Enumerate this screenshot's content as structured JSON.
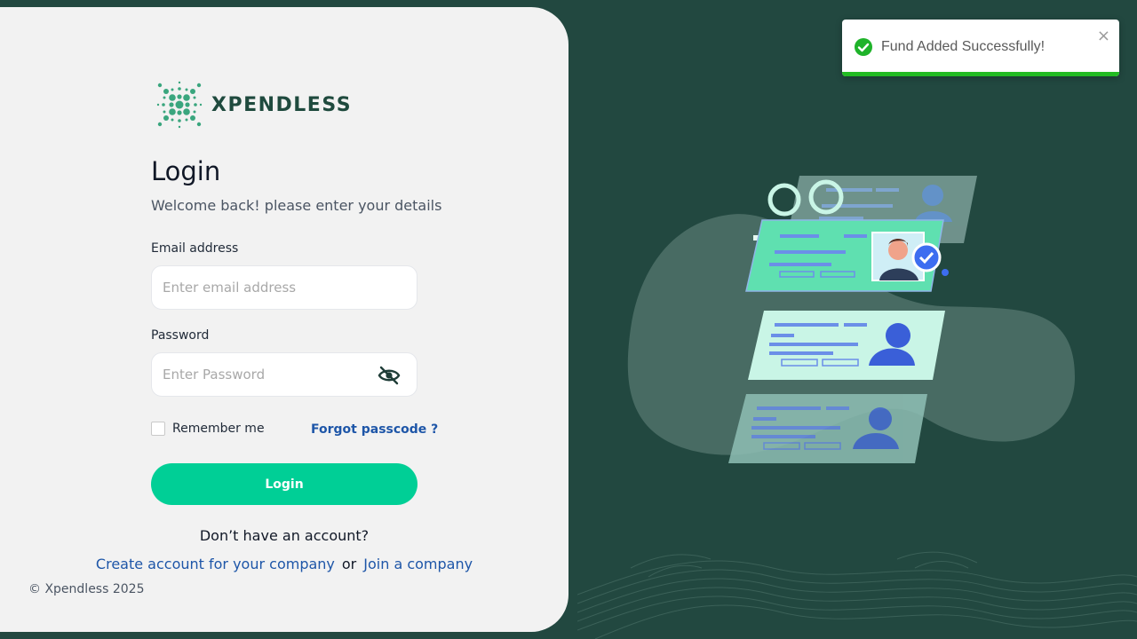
{
  "brand": {
    "name": "XPENDLESS",
    "color": "#1f4a3e",
    "accent": "#3aa67e"
  },
  "login": {
    "title": "Login",
    "subtitle": "Welcome back! please enter your details",
    "email_label": "Email address",
    "email_placeholder": "Enter email address",
    "email_value": "",
    "password_label": "Password",
    "password_placeholder": "Enter Password",
    "password_value": "",
    "remember_label": "Remember me",
    "remember_checked": false,
    "forgot_label": "Forgot passcode ?",
    "submit_label": "Login",
    "no_account_text": "Don’t have an account?",
    "create_company_label": "Create account for your company",
    "or_text": "or",
    "join_company_label": "Join a company"
  },
  "footer": {
    "copyright": "© Xpendless 2025"
  },
  "toast": {
    "message": "Fund Added Successfully!",
    "close_label": "×",
    "status": "success",
    "progress": 1.0,
    "color": "#22bb22"
  },
  "colors": {
    "background": "#224840",
    "panel": "#f2f2f2",
    "primary_button": "#00cf96",
    "link": "#1e56a8"
  },
  "icons": {
    "password_toggle": "eye-slash-icon",
    "toast_status": "check-circle-icon",
    "toast_close": "close-icon"
  }
}
